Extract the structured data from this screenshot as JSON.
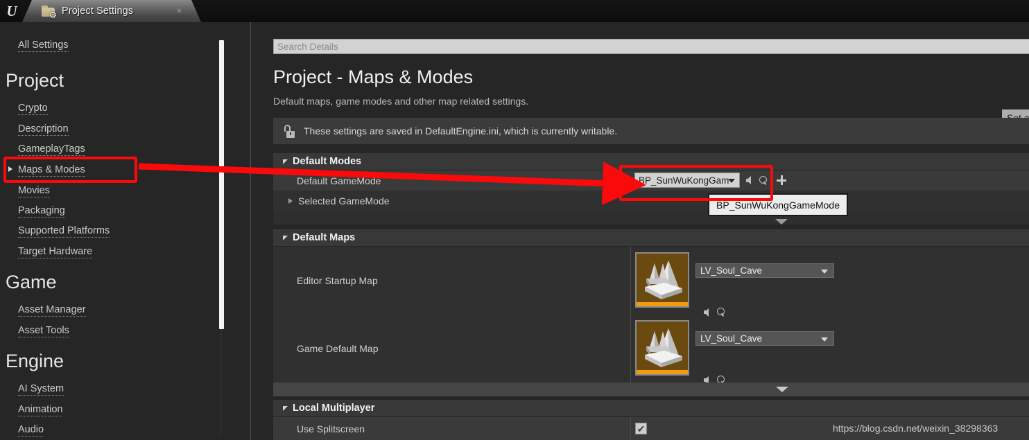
{
  "window": {
    "logo_glyph": "U",
    "tab_title": "Project Settings",
    "tab_close_glyph": "×"
  },
  "sidebar": {
    "all_settings_label": "All Settings",
    "sections": [
      {
        "heading": "Project",
        "items": [
          {
            "label": "Crypto",
            "selected": false
          },
          {
            "label": "Description",
            "selected": false
          },
          {
            "label": "GameplayTags",
            "selected": false
          },
          {
            "label": "Maps & Modes",
            "selected": true
          },
          {
            "label": "Movies",
            "selected": false
          },
          {
            "label": "Packaging",
            "selected": false
          },
          {
            "label": "Supported Platforms",
            "selected": false
          },
          {
            "label": "Target Hardware",
            "selected": false
          }
        ]
      },
      {
        "heading": "Game",
        "items": [
          {
            "label": "Asset Manager",
            "selected": false
          },
          {
            "label": "Asset Tools",
            "selected": false
          }
        ]
      },
      {
        "heading": "Engine",
        "items": [
          {
            "label": "AI System",
            "selected": false
          },
          {
            "label": "Animation",
            "selected": false
          },
          {
            "label": "Audio",
            "selected": false
          }
        ]
      }
    ]
  },
  "main": {
    "search_placeholder": "Search Details",
    "search_value": "",
    "page_title": "Project - Maps & Modes",
    "page_subtitle": "Default maps, game modes and other map related settings.",
    "set_as_default_label": "Set a",
    "notice_text": "These settings are saved in DefaultEngine.ini, which is currently writable.",
    "notice_icon": "unlocked-padlock-icon",
    "sections": [
      {
        "title": "Default Modes",
        "rows": [
          {
            "label": "Default GameMode",
            "value": "BP_SunWuKongGam",
            "control": "asset-combo",
            "buttons": [
              "browse-back-icon",
              "search-icon",
              "plus-icon"
            ]
          },
          {
            "label": "Selected GameMode",
            "expandable": true,
            "value": "",
            "control": "expandable"
          }
        ]
      },
      {
        "title": "Default Maps",
        "rows": [
          {
            "label": "Editor Startup Map",
            "value": "LV_Soul_Cave",
            "control": "map-combo",
            "thumbnail": "level-asset-thumbnail",
            "buttons": [
              "browse-back-icon",
              "search-icon"
            ]
          },
          {
            "label": "Game Default Map",
            "value": "LV_Soul_Cave",
            "control": "map-combo",
            "thumbnail": "level-asset-thumbnail",
            "buttons": [
              "browse-back-icon",
              "search-icon"
            ]
          }
        ]
      },
      {
        "title": "Local Multiplayer",
        "rows": [
          {
            "label": "Use Splitscreen",
            "value": "checked",
            "control": "checkbox",
            "check_glyph": "✔"
          }
        ]
      }
    ],
    "tooltip_text": "BP_SunWuKongGameMode",
    "watermark": "https://blog.csdn.net/weixin_38298363"
  },
  "annotations": {
    "highlight_color": "#fa0a0a",
    "boxes": [
      {
        "target": "sidebar-item-maps-modes"
      },
      {
        "target": "default-gamemode-combo"
      }
    ],
    "arrow": {
      "from": "sidebar-item-maps-modes",
      "to": "default-gamemode-combo"
    }
  }
}
